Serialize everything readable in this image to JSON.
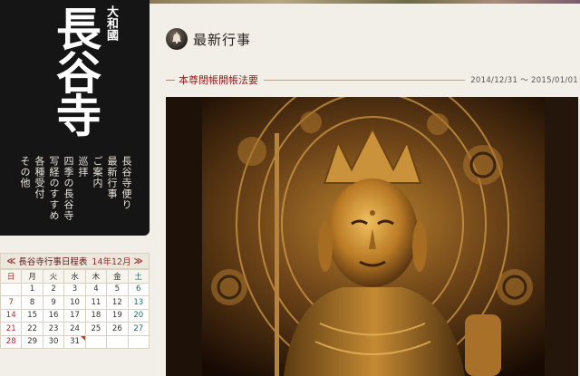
{
  "logo": {
    "province": "大和國",
    "temple_name": "長谷寺"
  },
  "nav": {
    "items": [
      {
        "label": "長谷寺便り"
      },
      {
        "label": "最新行事"
      },
      {
        "label": "ご案内"
      },
      {
        "label": "巡拝"
      },
      {
        "label": "四季の長谷寺"
      },
      {
        "label": "写経のすすめ"
      },
      {
        "label": "各種受付"
      },
      {
        "label": "その他"
      }
    ]
  },
  "calendar": {
    "prev": "≪",
    "title": "長谷寺行事日程表",
    "month": "14年12月",
    "next": "≫",
    "weekdays": [
      "日",
      "月",
      "火",
      "水",
      "木",
      "金",
      "土"
    ],
    "weeks": [
      [
        "",
        "1",
        "2",
        "3",
        "4",
        "5",
        "6"
      ],
      [
        "7",
        "8",
        "9",
        "10",
        "11",
        "12",
        "13"
      ],
      [
        "14",
        "15",
        "16",
        "17",
        "18",
        "19",
        "20"
      ],
      [
        "21",
        "22",
        "23",
        "24",
        "25",
        "26",
        "27"
      ],
      [
        "28",
        "29",
        "30",
        "31",
        "",
        "",
        ""
      ]
    ],
    "marked_day": "31"
  },
  "main": {
    "section_title": "最新行事",
    "article": {
      "title": "本尊閉帳開帳法要",
      "date_range": "2014/12/31 ～ 2015/01/01"
    },
    "photo_icon": "buddha-statue-photo"
  },
  "colors": {
    "nav_bg": "#151515",
    "page_bg": "#f2efe8",
    "accent_red": "#8f1f1f"
  }
}
